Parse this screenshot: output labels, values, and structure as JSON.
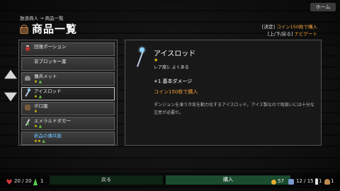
{
  "header": {
    "home_label": "ホーム",
    "breadcrumb": "放浪商人 → 商品一覧",
    "title": "商品一覧",
    "title_icon": "treasure-chest-icon",
    "hint_confirm_prefix": "[決定]",
    "hint_confirm_action": "コイン150枚で購入",
    "hint_switch_prefix": "[上/下/戻る]",
    "hint_switch_action": "ナビゲート"
  },
  "items": [
    {
      "name": "回復ポーション",
      "icon": "potion-icon",
      "stars": "",
      "tri": ""
    },
    {
      "name": "非ブロッキー薬",
      "icon": "none",
      "stars": "",
      "tri": ""
    },
    {
      "name": "傭兵メット",
      "icon": "helmet-icon",
      "stars": "★",
      "tri": "▲"
    },
    {
      "name": "アイスロッド",
      "icon": "rod-icon",
      "stars": "★",
      "tri": "▲"
    },
    {
      "name": "ボロ服",
      "icon": "cloth-icon",
      "stars": "★",
      "tri": ""
    },
    {
      "name": "エメラルドダガー",
      "icon": "dagger-icon",
      "stars": "★",
      "tri": "▲"
    },
    {
      "name": "新品の傭兵服",
      "icon": "none",
      "stars": "★★",
      "tri": "▲"
    }
  ],
  "selected_index": 3,
  "detail": {
    "name": "アイスロッド",
    "stars": "★",
    "rarity": "レア度1: よくある",
    "effect": "+1 基本ダメージ",
    "price": "コイン150枚で購入",
    "description": "ダンジョンを凍う冷気を動力化するアイスロッド。アイス製なので取扱いには十分な注意が必要だ。"
  },
  "footer": {
    "hp": "20 / 20",
    "mp": "1",
    "back_label": "戻る",
    "buy_label": "購入",
    "gold": "57",
    "bag": "12 / 15",
    "keys": "1",
    "food": "1"
  },
  "colors": {
    "accent": "#f0a038",
    "highlight": "#6ec4ff",
    "star": "#f0d000",
    "buy_button": "#1b4c30"
  }
}
